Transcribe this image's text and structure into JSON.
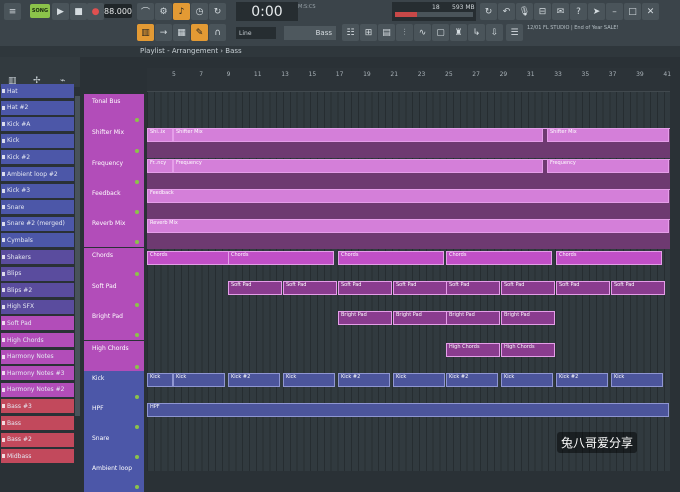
{
  "toolbar": {
    "song_label": "SONG",
    "tempo": "88.000",
    "time": "0:00",
    "time_unit": "M:S:CS",
    "cpu_value": "18",
    "cpu_fraction": 0.28,
    "memory": "593 MB",
    "line_mode": "Line",
    "pattern": "Bass",
    "news": "12/01 FL STUDIO | End of Year SALE!",
    "icons": [
      "play-icon",
      "stop-icon",
      "record-icon",
      "snap-icon",
      "mixer-icon",
      "piano-roll-icon",
      "browser-icon",
      "plugin-icon",
      "undo-icon",
      "save-icon",
      "mic-icon",
      "help-icon"
    ]
  },
  "playlist": {
    "title": "Playlist - Arrangement › Bass",
    "ruler_numbers": [
      "5",
      "7",
      "9",
      "11",
      "13",
      "15",
      "17",
      "19",
      "21",
      "23",
      "25",
      "27",
      "29",
      "31",
      "33",
      "35",
      "37",
      "39",
      "41",
      "43"
    ]
  },
  "channels": [
    {
      "name": "Hat"
    },
    {
      "name": "Hat #2"
    },
    {
      "name": "Kick #A"
    },
    {
      "name": "Kick"
    },
    {
      "name": "Kick #2"
    },
    {
      "name": "Ambient loop #2"
    },
    {
      "name": "Kick #3"
    },
    {
      "name": "Snare"
    },
    {
      "name": "Snare #2 (merged)"
    },
    {
      "name": "Cymbals"
    },
    {
      "name": "Shakers"
    },
    {
      "name": "Blips"
    },
    {
      "name": "Blips #2"
    },
    {
      "name": "High SFX"
    },
    {
      "name": "Soft Pad"
    },
    {
      "name": "High Chords"
    },
    {
      "name": "Harmony Notes"
    },
    {
      "name": "Harmony Notes #3"
    },
    {
      "name": "Harmony Notes #2"
    },
    {
      "name": "Bass #3"
    },
    {
      "name": "Bass"
    },
    {
      "name": "Bass #2"
    },
    {
      "name": "Midbass"
    }
  ],
  "tracks": [
    {
      "name": "Tonal Bus"
    },
    {
      "name": "Shifter Mix"
    },
    {
      "name": "Frequency"
    },
    {
      "name": "Feedback"
    },
    {
      "name": "Reverb Mix"
    },
    {
      "name": "Chords"
    },
    {
      "name": "Soft Pad"
    },
    {
      "name": "Bright Pad"
    },
    {
      "name": "High Chords"
    },
    {
      "name": "Kick"
    },
    {
      "name": "HPF"
    },
    {
      "name": "Snare"
    },
    {
      "name": "Ambient loop"
    }
  ],
  "clips": {
    "shifter": [
      "Shi..ix",
      "Shifter Mix",
      "Shifter Mix"
    ],
    "frequency": [
      "Fr..ncy",
      "Frequency",
      "Frequency"
    ],
    "feedback": "Feedback",
    "reverb": "Reverb Mix",
    "chords": "Chords",
    "soft_pad": "Soft Pad",
    "bright_pad": "Bright Pad",
    "high_chords": "High Chords",
    "kick": "Kick",
    "kick2": "Kick #2",
    "hpf": "HPF"
  },
  "watermark": "兔八哥爱分享"
}
